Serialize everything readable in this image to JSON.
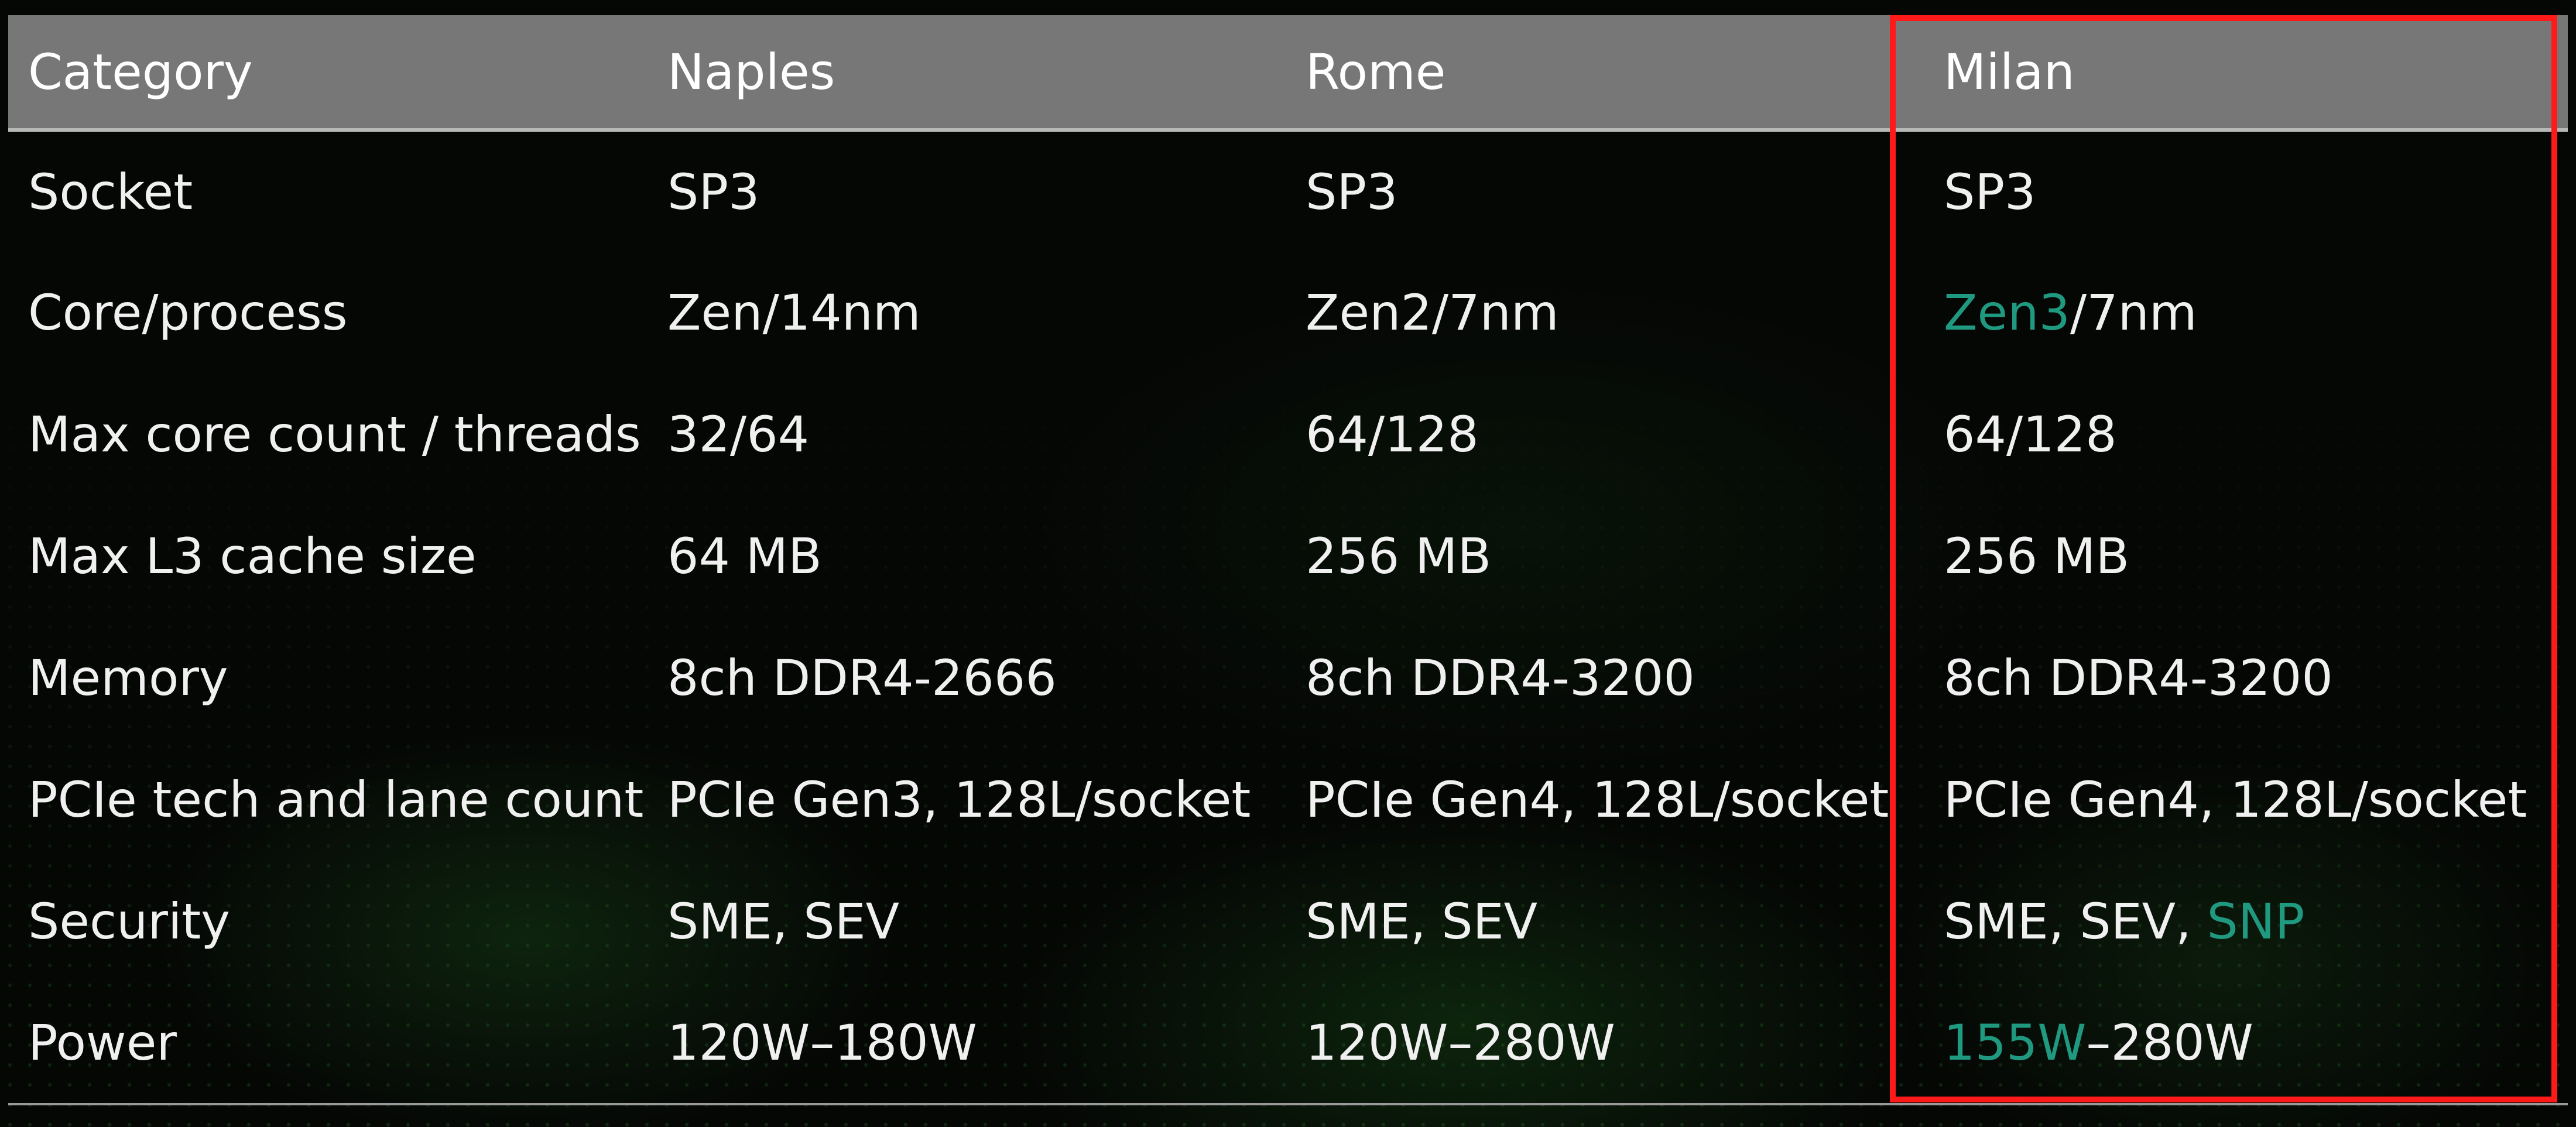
{
  "table": {
    "headers": [
      "Category",
      "Naples",
      "Rome",
      "Milan"
    ],
    "rows": [
      {
        "category": "Socket",
        "naples": "SP3",
        "rome": "SP3",
        "milan": "SP3"
      },
      {
        "category": "Core/process",
        "naples": "Zen/14nm",
        "rome": "Zen2/7nm",
        "milan_accent": "Zen3",
        "milan_rest": "/7nm"
      },
      {
        "category": "Max core count / threads",
        "naples": "32/64",
        "rome": "64/128",
        "milan": "64/128"
      },
      {
        "category": "Max L3 cache size",
        "naples": "64 MB",
        "rome": "256 MB",
        "milan": "256 MB"
      },
      {
        "category": "Memory",
        "naples": "8ch DDR4-2666",
        "rome": "8ch DDR4-3200",
        "milan": "8ch DDR4-3200"
      },
      {
        "category": "PCIe tech and lane count",
        "naples": "PCIe Gen3, 128L/socket",
        "rome": "PCIe Gen4, 128L/socket",
        "milan": "PCIe Gen4, 128L/socket"
      },
      {
        "category": "Security",
        "naples": "SME, SEV",
        "rome": "SME, SEV",
        "milan_rest": "SME, SEV, ",
        "milan_accent": "SNP"
      },
      {
        "category": "Power",
        "naples": "120W–180W",
        "rome": "120W–280W",
        "milan_accent": "155W",
        "milan_rest": "–280W"
      }
    ]
  },
  "colors": {
    "header_bg": "#777777",
    "accent_text": "#1f9a80",
    "highlight_border": "#ff1a1a",
    "background": "#050705"
  }
}
